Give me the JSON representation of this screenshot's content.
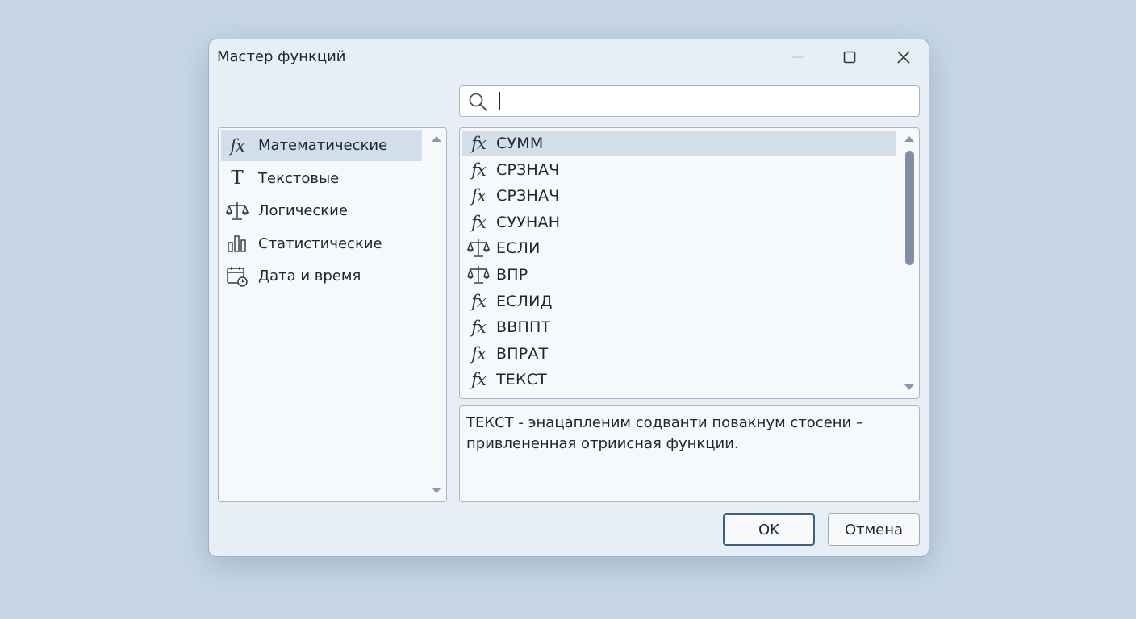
{
  "window": {
    "title": "Мастер функций"
  },
  "search": {
    "value": "",
    "placeholder": ""
  },
  "categories": [
    {
      "icon": "fx-icon",
      "label": "Математические",
      "selected": true
    },
    {
      "icon": "text-t-icon",
      "label": "Текстовые",
      "selected": false
    },
    {
      "icon": "scales-icon",
      "label": "Логические",
      "selected": false
    },
    {
      "icon": "bar-chart-icon",
      "label": "Статистические",
      "selected": false
    },
    {
      "icon": "calendar-clock-icon",
      "label": "Дата и время",
      "selected": false
    }
  ],
  "functions": [
    {
      "icon": "fx-icon",
      "label": "СУММ",
      "selected": true
    },
    {
      "icon": "fx-icon",
      "label": "СРЗНАЧ",
      "selected": false
    },
    {
      "icon": "fx-icon",
      "label": "СРЗНАЧ",
      "selected": false
    },
    {
      "icon": "fx-icon",
      "label": "СУУНАН",
      "selected": false
    },
    {
      "icon": "scales-icon",
      "label": "ЕСЛИ",
      "selected": false
    },
    {
      "icon": "scales-icon",
      "label": "ВПР",
      "selected": false
    },
    {
      "icon": "fx-icon",
      "label": "ЕСЛИД",
      "selected": false
    },
    {
      "icon": "fx-icon",
      "label": "ВВППТ",
      "selected": false
    },
    {
      "icon": "fx-icon",
      "label": "ВПРАТ",
      "selected": false
    },
    {
      "icon": "fx-icon",
      "label": "ТЕКСТ",
      "selected": false
    }
  ],
  "description": "ТЕКСТ - энацапленим содванти повакнум стосени – привлененная отриисная функции.",
  "buttons": {
    "ok": "OK",
    "cancel": "Отмена"
  },
  "colors": {
    "selection": "#d2dfea",
    "ok_border": "#3c5f84",
    "background": "#c7d7e6"
  }
}
